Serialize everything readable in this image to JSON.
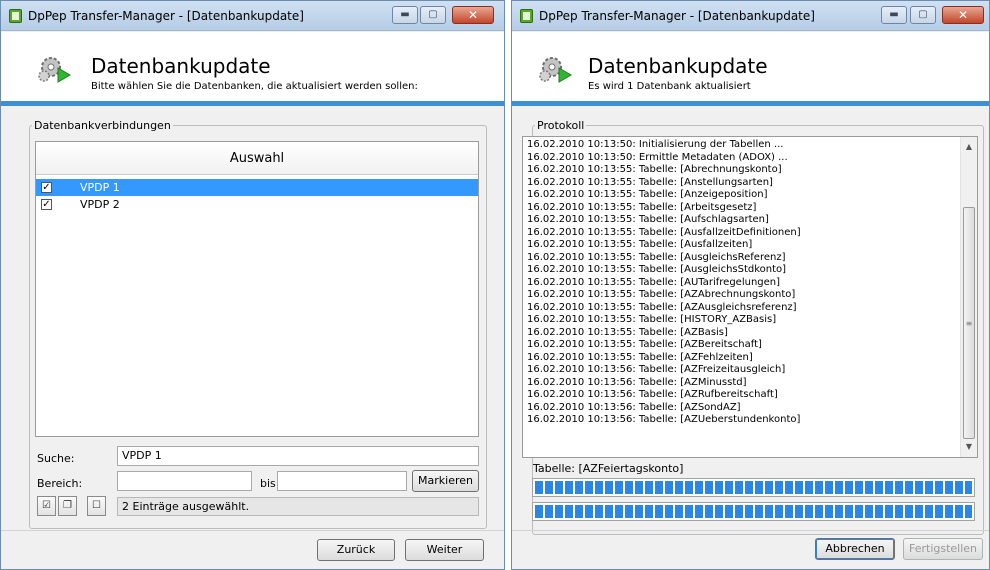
{
  "left_window": {
    "title": "DpPep Transfer-Manager - [Datenbankupdate]",
    "header_title": "Datenbankupdate",
    "header_subtitle": "Bitte wählen Sie die Datenbanken, die aktualisiert werden sollen:",
    "groupbox_label": "Datenbankverbindungen",
    "list_header": "Auswahl",
    "items": [
      {
        "label": "VPDP 1",
        "checked": true,
        "selected": true
      },
      {
        "label": "VPDP 2",
        "checked": true,
        "selected": false
      }
    ],
    "search_label": "Suche:",
    "search_value": "VPDP 1",
    "range_label": "Bereich:",
    "range_from": "",
    "range_to_label": "bis",
    "range_to": "",
    "mark_button": "Markieren",
    "status": "2 Einträge  ausgewählt.",
    "back_button": "Zurück",
    "next_button": "Weiter"
  },
  "right_window": {
    "title": "DpPep Transfer-Manager - [Datenbankupdate]",
    "header_title": "Datenbankupdate",
    "header_subtitle": "Es wird 1 Datenbank aktualisiert",
    "groupbox_label": "Protokoll",
    "log": [
      "16.02.2010 10:13:50: Initialisierung der Tabellen ...",
      "16.02.2010 10:13:50: Ermittle Metadaten (ADOX) ...",
      "16.02.2010 10:13:55: Tabelle: [Abrechnungskonto]",
      "16.02.2010 10:13:55: Tabelle: [Anstellungsarten]",
      "16.02.2010 10:13:55: Tabelle: [Anzeigeposition]",
      "16.02.2010 10:13:55: Tabelle: [Arbeitsgesetz]",
      "16.02.2010 10:13:55: Tabelle: [Aufschlagsarten]",
      "16.02.2010 10:13:55: Tabelle: [AusfallzeitDefinitionen]",
      "16.02.2010 10:13:55: Tabelle: [Ausfallzeiten]",
      "16.02.2010 10:13:55: Tabelle: [AusgleichsReferenz]",
      "16.02.2010 10:13:55: Tabelle: [AusgleichsStdkonto]",
      "16.02.2010 10:13:55: Tabelle: [AUTarifregelungen]",
      "16.02.2010 10:13:55: Tabelle: [AZAbrechnungskonto]",
      "16.02.2010 10:13:55: Tabelle: [AZAusgleichsreferenz]",
      "16.02.2010 10:13:55: Tabelle: [HISTORY_AZBasis]",
      "16.02.2010 10:13:55: Tabelle: [AZBasis]",
      "16.02.2010 10:13:55: Tabelle: [AZBereitschaft]",
      "16.02.2010 10:13:55: Tabelle: [AZFehlzeiten]",
      "16.02.2010 10:13:56: Tabelle: [AZFreizeitausgleich]",
      "16.02.2010 10:13:56: Tabelle: [AZMinusstd]",
      "16.02.2010 10:13:56: Tabelle: [AZRufbereitschaft]",
      "16.02.2010 10:13:56: Tabelle: [AZSondAZ]",
      "16.02.2010 10:13:56: Tabelle: [AZUeberstundenkonto]"
    ],
    "current_table": "Tabelle: [AZFeiertagskonto]",
    "progress_1": 1.0,
    "progress_2": 1.0,
    "cancel_button": "Abbrechen",
    "finish_button": "Fertigstellen"
  },
  "colors": {
    "accent": "#3d8fd6",
    "selection": "#3399ff",
    "progress": "#2c86e3"
  }
}
